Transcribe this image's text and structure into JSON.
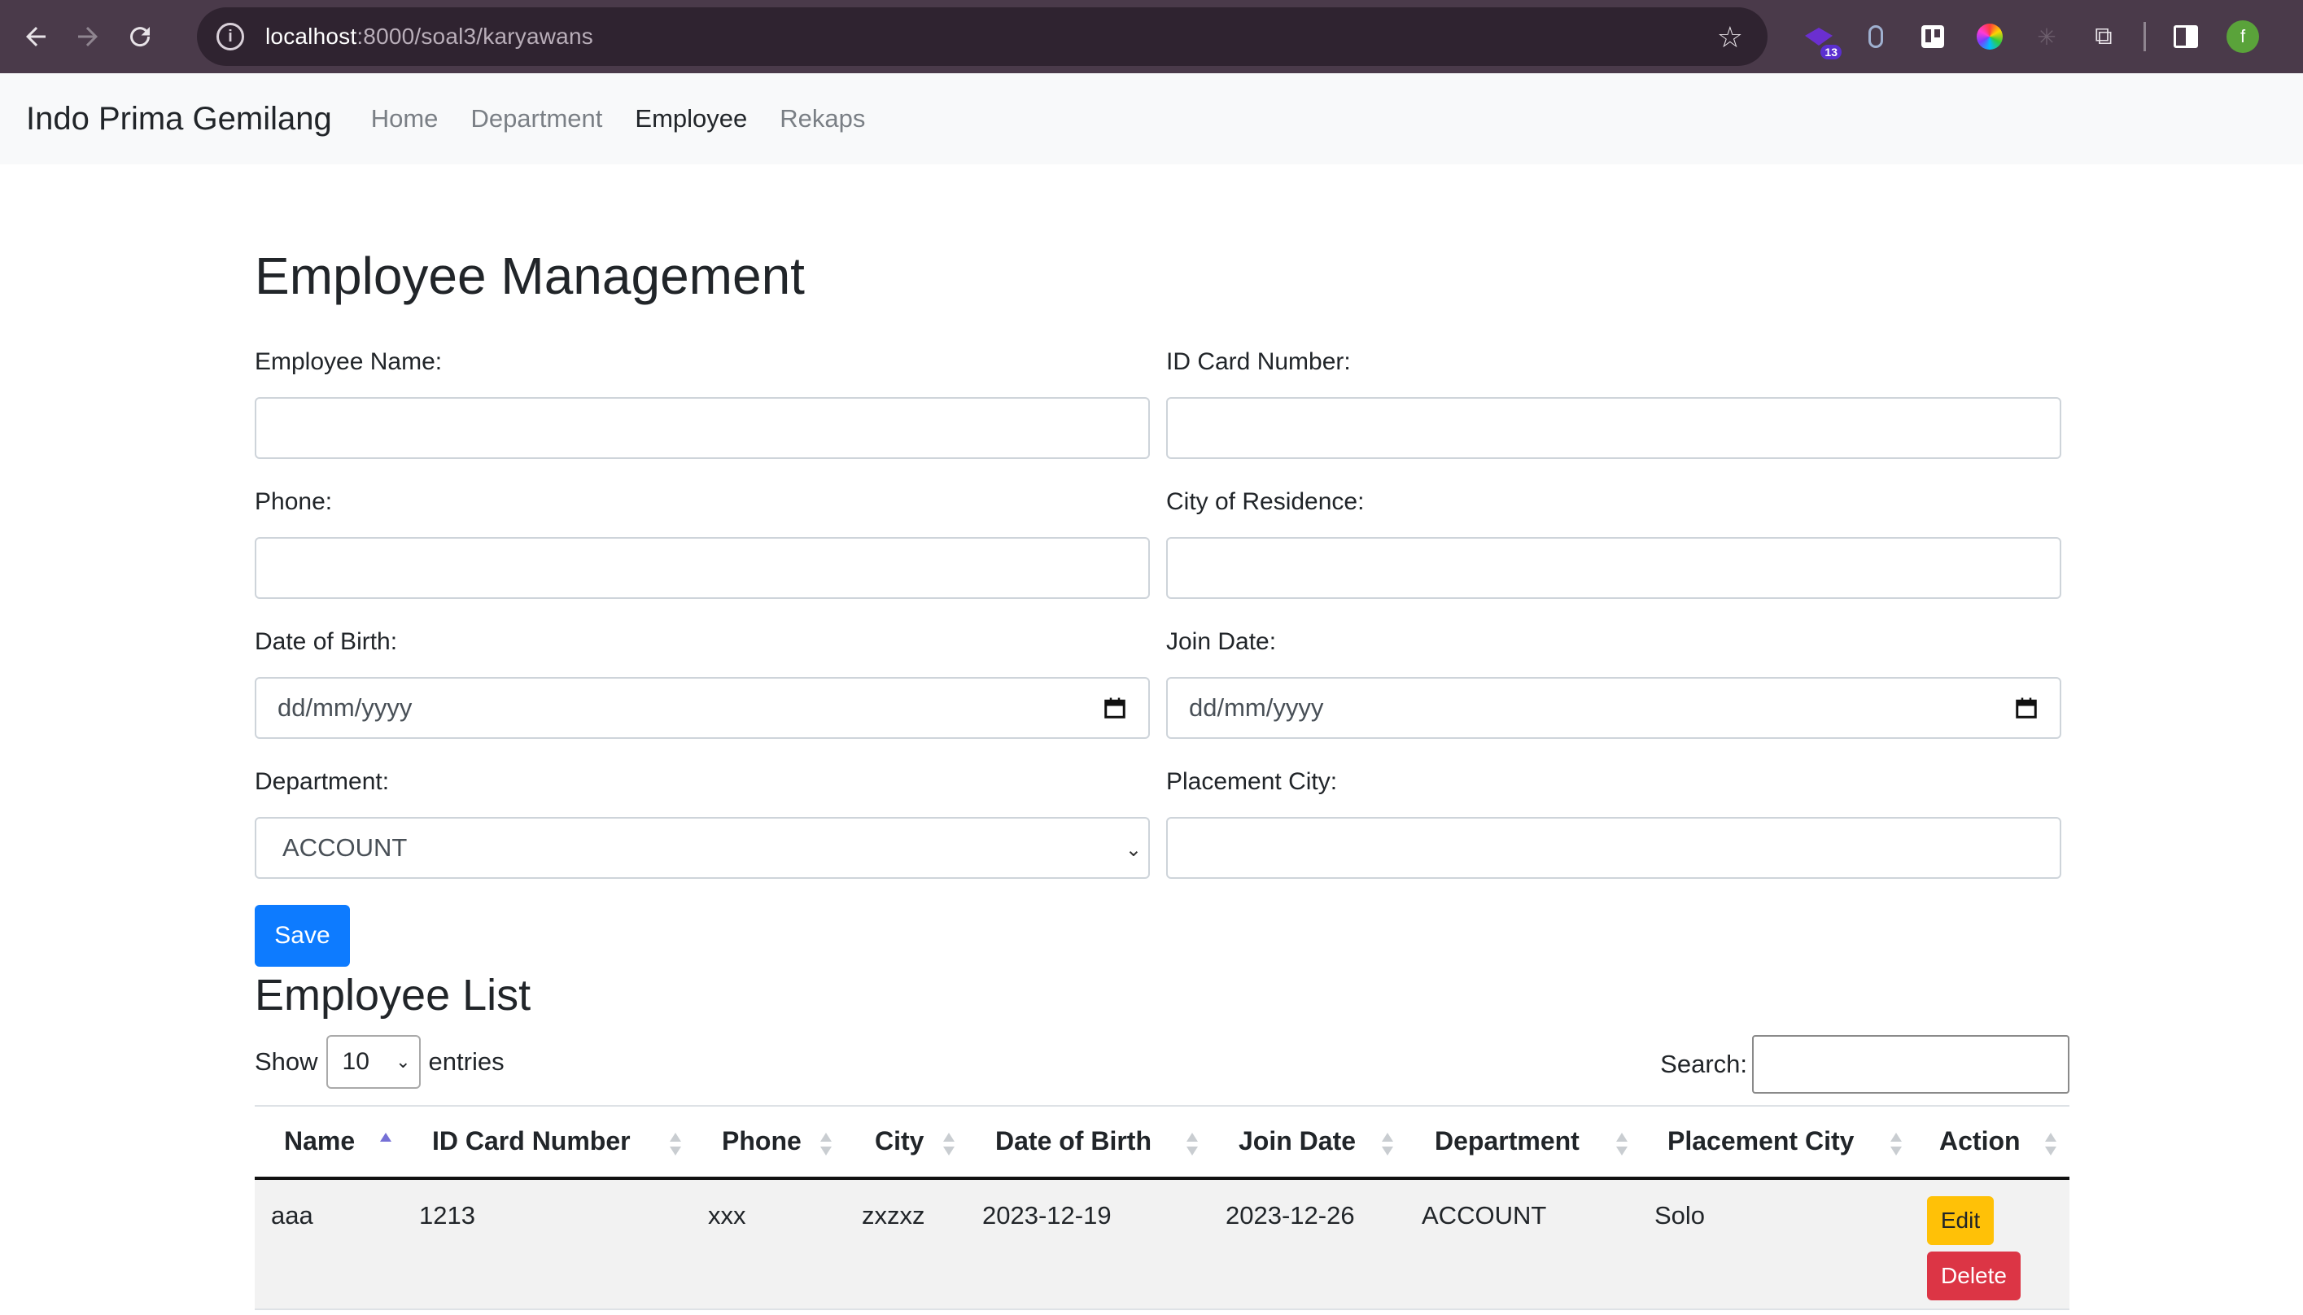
{
  "browser": {
    "url_host": "localhost",
    "url_path": ":8000/soal3/karyawans",
    "extension_badge": "13",
    "profile_initial": "f"
  },
  "navbar": {
    "brand": "Indo Prima Gemilang",
    "links": [
      {
        "label": "Home",
        "active": false
      },
      {
        "label": "Department",
        "active": false
      },
      {
        "label": "Employee",
        "active": true
      },
      {
        "label": "Rekaps",
        "active": false
      }
    ]
  },
  "form": {
    "title": "Employee Management",
    "employee_name_label": "Employee Name:",
    "employee_name_value": "",
    "id_card_label": "ID Card Number:",
    "id_card_value": "",
    "phone_label": "Phone:",
    "phone_value": "",
    "city_label": "City of Residence:",
    "city_value": "",
    "dob_label": "Date of Birth:",
    "dob_placeholder": "dd/mm/yyyy",
    "join_label": "Join Date:",
    "join_placeholder": "dd/mm/yyyy",
    "department_label": "Department:",
    "department_selected": "ACCOUNT",
    "placement_label": "Placement City:",
    "placement_value": "",
    "save_label": "Save"
  },
  "list": {
    "title": "Employee List",
    "show_label": "Show",
    "entries_value": "10",
    "entries_label": "entries",
    "search_label": "Search:",
    "columns": [
      "Name",
      "ID Card Number",
      "Phone",
      "City",
      "Date of Birth",
      "Join Date",
      "Department",
      "Placement City",
      "Action"
    ],
    "sorted_column": "Name",
    "rows": [
      {
        "name": "aaa",
        "id_card": "1213",
        "phone": "xxx",
        "city": "zxzxz",
        "dob": "2023-12-19",
        "join_date": "2023-12-26",
        "department": "ACCOUNT",
        "placement": "Solo",
        "edit_label": "Edit",
        "delete_label": "Delete"
      }
    ]
  }
}
